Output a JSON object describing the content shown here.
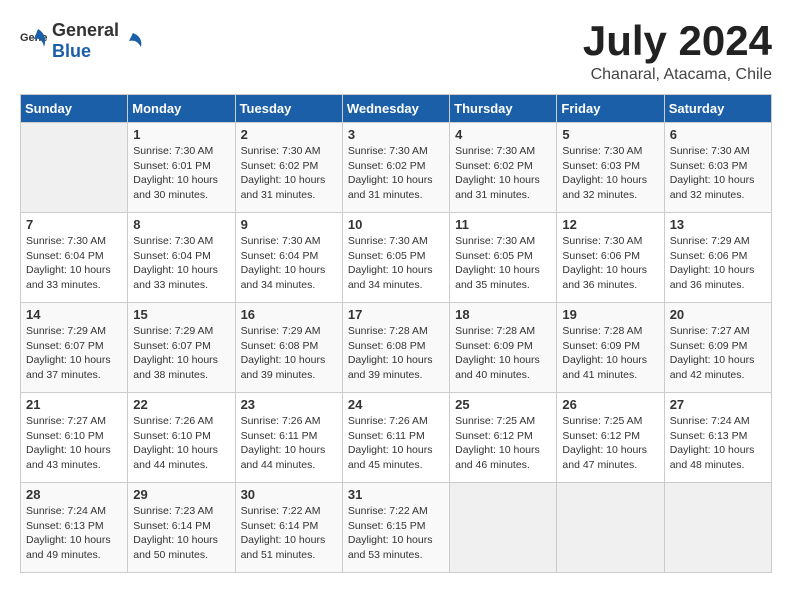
{
  "header": {
    "logo_general": "General",
    "logo_blue": "Blue",
    "month_title": "July 2024",
    "location": "Chanaral, Atacama, Chile"
  },
  "days_of_week": [
    "Sunday",
    "Monday",
    "Tuesday",
    "Wednesday",
    "Thursday",
    "Friday",
    "Saturday"
  ],
  "weeks": [
    [
      {
        "day": "",
        "info": ""
      },
      {
        "day": "1",
        "info": "Sunrise: 7:30 AM\nSunset: 6:01 PM\nDaylight: 10 hours\nand 30 minutes."
      },
      {
        "day": "2",
        "info": "Sunrise: 7:30 AM\nSunset: 6:02 PM\nDaylight: 10 hours\nand 31 minutes."
      },
      {
        "day": "3",
        "info": "Sunrise: 7:30 AM\nSunset: 6:02 PM\nDaylight: 10 hours\nand 31 minutes."
      },
      {
        "day": "4",
        "info": "Sunrise: 7:30 AM\nSunset: 6:02 PM\nDaylight: 10 hours\nand 31 minutes."
      },
      {
        "day": "5",
        "info": "Sunrise: 7:30 AM\nSunset: 6:03 PM\nDaylight: 10 hours\nand 32 minutes."
      },
      {
        "day": "6",
        "info": "Sunrise: 7:30 AM\nSunset: 6:03 PM\nDaylight: 10 hours\nand 32 minutes."
      }
    ],
    [
      {
        "day": "7",
        "info": "Sunrise: 7:30 AM\nSunset: 6:04 PM\nDaylight: 10 hours\nand 33 minutes."
      },
      {
        "day": "8",
        "info": "Sunrise: 7:30 AM\nSunset: 6:04 PM\nDaylight: 10 hours\nand 33 minutes."
      },
      {
        "day": "9",
        "info": "Sunrise: 7:30 AM\nSunset: 6:04 PM\nDaylight: 10 hours\nand 34 minutes."
      },
      {
        "day": "10",
        "info": "Sunrise: 7:30 AM\nSunset: 6:05 PM\nDaylight: 10 hours\nand 34 minutes."
      },
      {
        "day": "11",
        "info": "Sunrise: 7:30 AM\nSunset: 6:05 PM\nDaylight: 10 hours\nand 35 minutes."
      },
      {
        "day": "12",
        "info": "Sunrise: 7:30 AM\nSunset: 6:06 PM\nDaylight: 10 hours\nand 36 minutes."
      },
      {
        "day": "13",
        "info": "Sunrise: 7:29 AM\nSunset: 6:06 PM\nDaylight: 10 hours\nand 36 minutes."
      }
    ],
    [
      {
        "day": "14",
        "info": "Sunrise: 7:29 AM\nSunset: 6:07 PM\nDaylight: 10 hours\nand 37 minutes."
      },
      {
        "day": "15",
        "info": "Sunrise: 7:29 AM\nSunset: 6:07 PM\nDaylight: 10 hours\nand 38 minutes."
      },
      {
        "day": "16",
        "info": "Sunrise: 7:29 AM\nSunset: 6:08 PM\nDaylight: 10 hours\nand 39 minutes."
      },
      {
        "day": "17",
        "info": "Sunrise: 7:28 AM\nSunset: 6:08 PM\nDaylight: 10 hours\nand 39 minutes."
      },
      {
        "day": "18",
        "info": "Sunrise: 7:28 AM\nSunset: 6:09 PM\nDaylight: 10 hours\nand 40 minutes."
      },
      {
        "day": "19",
        "info": "Sunrise: 7:28 AM\nSunset: 6:09 PM\nDaylight: 10 hours\nand 41 minutes."
      },
      {
        "day": "20",
        "info": "Sunrise: 7:27 AM\nSunset: 6:09 PM\nDaylight: 10 hours\nand 42 minutes."
      }
    ],
    [
      {
        "day": "21",
        "info": "Sunrise: 7:27 AM\nSunset: 6:10 PM\nDaylight: 10 hours\nand 43 minutes."
      },
      {
        "day": "22",
        "info": "Sunrise: 7:26 AM\nSunset: 6:10 PM\nDaylight: 10 hours\nand 44 minutes."
      },
      {
        "day": "23",
        "info": "Sunrise: 7:26 AM\nSunset: 6:11 PM\nDaylight: 10 hours\nand 44 minutes."
      },
      {
        "day": "24",
        "info": "Sunrise: 7:26 AM\nSunset: 6:11 PM\nDaylight: 10 hours\nand 45 minutes."
      },
      {
        "day": "25",
        "info": "Sunrise: 7:25 AM\nSunset: 6:12 PM\nDaylight: 10 hours\nand 46 minutes."
      },
      {
        "day": "26",
        "info": "Sunrise: 7:25 AM\nSunset: 6:12 PM\nDaylight: 10 hours\nand 47 minutes."
      },
      {
        "day": "27",
        "info": "Sunrise: 7:24 AM\nSunset: 6:13 PM\nDaylight: 10 hours\nand 48 minutes."
      }
    ],
    [
      {
        "day": "28",
        "info": "Sunrise: 7:24 AM\nSunset: 6:13 PM\nDaylight: 10 hours\nand 49 minutes."
      },
      {
        "day": "29",
        "info": "Sunrise: 7:23 AM\nSunset: 6:14 PM\nDaylight: 10 hours\nand 50 minutes."
      },
      {
        "day": "30",
        "info": "Sunrise: 7:22 AM\nSunset: 6:14 PM\nDaylight: 10 hours\nand 51 minutes."
      },
      {
        "day": "31",
        "info": "Sunrise: 7:22 AM\nSunset: 6:15 PM\nDaylight: 10 hours\nand 53 minutes."
      },
      {
        "day": "",
        "info": ""
      },
      {
        "day": "",
        "info": ""
      },
      {
        "day": "",
        "info": ""
      }
    ]
  ]
}
